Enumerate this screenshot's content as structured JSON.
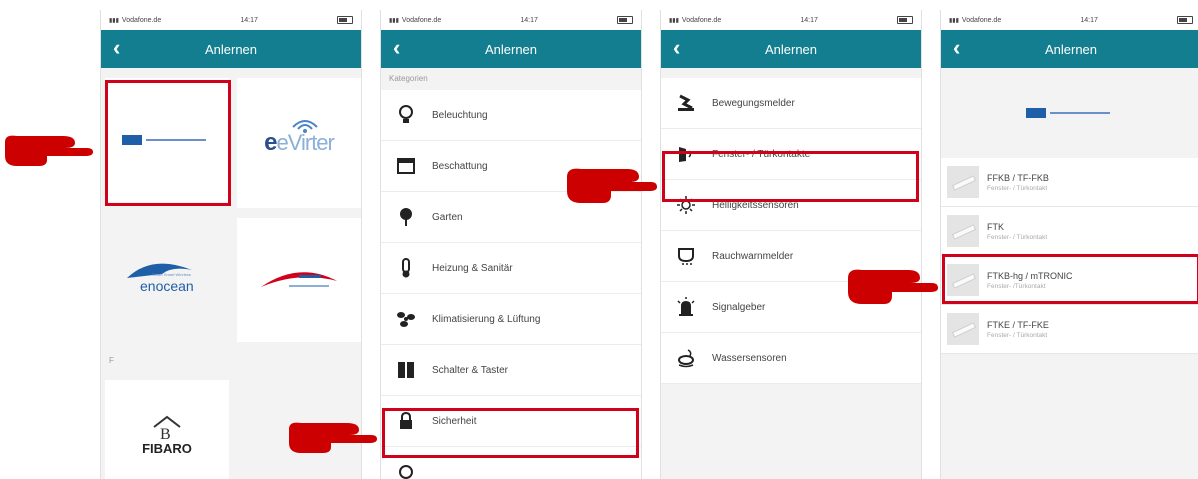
{
  "status": {
    "carrier": "Vodafone.de",
    "time": "14:17"
  },
  "nav": {
    "title": "Anlernen",
    "back": "‹"
  },
  "screen1": {
    "brands": {
      "evertter": "eVirter",
      "fibaro": "FIBARO",
      "enocean": "enocean",
      "enocean_tag": "Smart Smart Wireless"
    },
    "section_f": "F"
  },
  "screen2": {
    "section": "Kategorien",
    "items": [
      {
        "label": "Beleuchtung",
        "icon": "bulb-icon"
      },
      {
        "label": "Beschattung",
        "icon": "shade-icon"
      },
      {
        "label": "Garten",
        "icon": "tree-icon"
      },
      {
        "label": "Heizung & Sanitär",
        "icon": "thermometer-icon"
      },
      {
        "label": "Klimatisierung & Lüftung",
        "icon": "fan-icon"
      },
      {
        "label": "Schalter & Taster",
        "icon": "switch-icon"
      },
      {
        "label": "Sicherheit",
        "icon": "lock-icon"
      }
    ]
  },
  "screen3": {
    "items": [
      {
        "label": "Bewegungsmelder",
        "icon": "motion-icon"
      },
      {
        "label": "Fenster- / Türkontakte",
        "icon": "door-contact-icon"
      },
      {
        "label": "Helligkeitssensoren",
        "icon": "sun-icon"
      },
      {
        "label": "Rauchwarnmelder",
        "icon": "smoke-detector-icon"
      },
      {
        "label": "Signalgeber",
        "icon": "siren-icon"
      },
      {
        "label": "Wassersensoren",
        "icon": "water-sensor-icon"
      }
    ]
  },
  "screen4": {
    "products": [
      {
        "name": "FFKB / TF-FKB",
        "sub": "Fenster- / Türkontakt"
      },
      {
        "name": "FTK",
        "sub": "Fenster- / Türkontakt"
      },
      {
        "name": "FTKB-hg / mTRONIC",
        "sub": "Fenster- /Türkontakt"
      },
      {
        "name": "FTKE / TF-FKE",
        "sub": "Fenster- / Türkontakt"
      }
    ]
  },
  "colors": {
    "navbar": "#137e8f",
    "highlight": "#d0021b",
    "brand_blue": "#1f5fa8"
  }
}
